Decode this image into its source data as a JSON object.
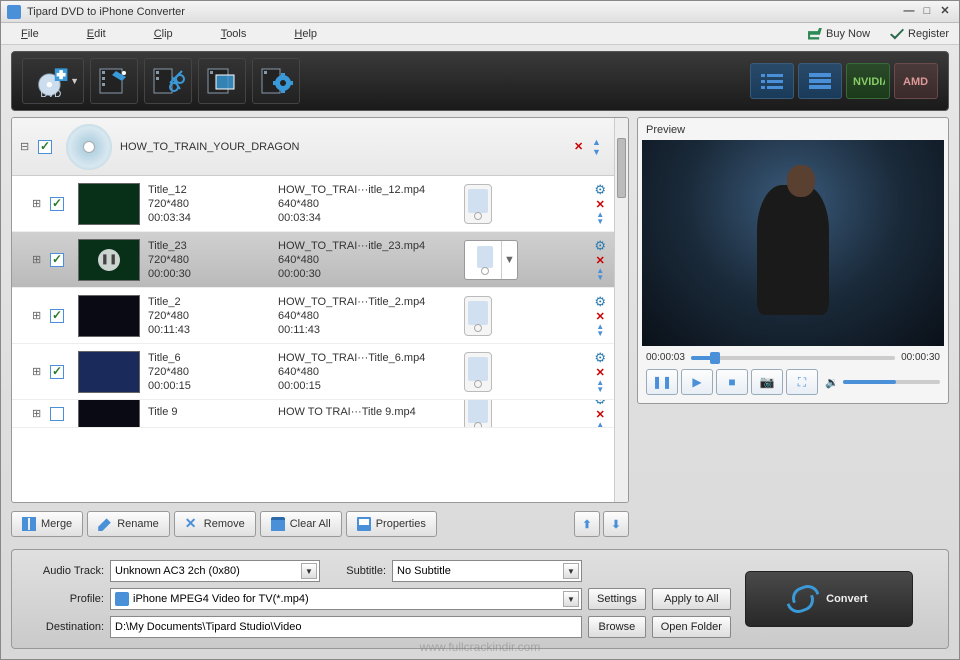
{
  "app": {
    "title": "Tipard DVD to iPhone Converter"
  },
  "menu": {
    "file": "File",
    "edit": "Edit",
    "clip": "Clip",
    "tools": "Tools",
    "help": "Help",
    "buy_now": "Buy Now",
    "register": "Register"
  },
  "disc": {
    "name": "HOW_TO_TRAIN_YOUR_DRAGON"
  },
  "titles": [
    {
      "name": "Title_12",
      "res": "720*480",
      "dur": "00:03:34",
      "out_name": "HOW_TO_TRAI···itle_12.mp4",
      "out_res": "640*480",
      "out_dur": "00:03:34",
      "selected": false,
      "checked": true,
      "thumb": "green"
    },
    {
      "name": "Title_23",
      "res": "720*480",
      "dur": "00:00:30",
      "out_name": "HOW_TO_TRAI···itle_23.mp4",
      "out_res": "640*480",
      "out_dur": "00:00:30",
      "selected": true,
      "checked": true,
      "thumb": "play"
    },
    {
      "name": "Title_2",
      "res": "720*480",
      "dur": "00:11:43",
      "out_name": "HOW_TO_TRAI···Title_2.mp4",
      "out_res": "640*480",
      "out_dur": "00:11:43",
      "selected": false,
      "checked": true,
      "thumb": "dark"
    },
    {
      "name": "Title_6",
      "res": "720*480",
      "dur": "00:00:15",
      "out_name": "HOW_TO_TRAI···Title_6.mp4",
      "out_res": "640*480",
      "out_dur": "00:00:15",
      "selected": false,
      "checked": true,
      "thumb": "blue"
    },
    {
      "name": "Title 9",
      "res": "",
      "dur": "",
      "out_name": "HOW TO TRAI···Title 9.mp4",
      "out_res": "",
      "out_dur": "",
      "selected": false,
      "checked": false,
      "thumb": "dark"
    }
  ],
  "actions": {
    "merge": "Merge",
    "rename": "Rename",
    "remove": "Remove",
    "clear_all": "Clear All",
    "properties": "Properties"
  },
  "preview": {
    "label": "Preview",
    "pos": "00:00:03",
    "dur": "00:00:30"
  },
  "settings": {
    "audio_track_label": "Audio Track:",
    "audio_track": "Unknown AC3 2ch (0x80)",
    "subtitle_label": "Subtitle:",
    "subtitle": "No Subtitle",
    "profile_label": "Profile:",
    "profile": "iPhone MPEG4 Video for TV(*.mp4)",
    "destination_label": "Destination:",
    "destination": "D:\\My Documents\\Tipard Studio\\Video",
    "settings_btn": "Settings",
    "apply_btn": "Apply to All",
    "browse_btn": "Browse",
    "open_folder_btn": "Open Folder"
  },
  "convert": {
    "label": "Convert"
  },
  "watermark": "www.fullcrackindir.com"
}
